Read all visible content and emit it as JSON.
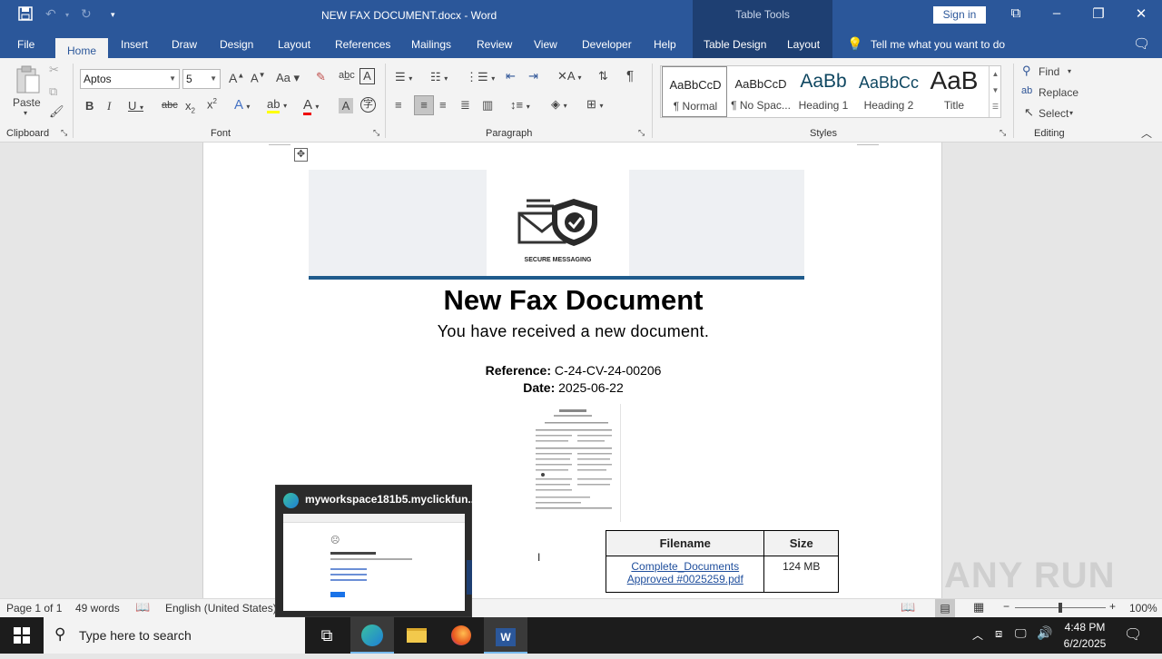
{
  "titlebar": {
    "doc_title": "NEW FAX DOCUMENT.docx  -  Word",
    "contextual_group": "Table Tools",
    "sign_in": "Sign in"
  },
  "tabs": {
    "file": "File",
    "home": "Home",
    "insert": "Insert",
    "draw": "Draw",
    "design": "Design",
    "layout": "Layout",
    "references": "References",
    "mailings": "Mailings",
    "review": "Review",
    "view": "View",
    "developer": "Developer",
    "help": "Help",
    "table_design": "Table Design",
    "table_layout": "Layout",
    "tell_me": "Tell me what you want to do"
  },
  "ribbon": {
    "clipboard": {
      "label": "Clipboard",
      "paste": "Paste"
    },
    "font": {
      "label": "Font",
      "name": "Aptos",
      "size": "5",
      "change_case": "Aa"
    },
    "paragraph": {
      "label": "Paragraph"
    },
    "styles": {
      "label": "Styles",
      "items": [
        {
          "preview": "AaBbCcD",
          "name": "¶ Normal"
        },
        {
          "preview": "AaBbCcD",
          "name": "¶ No Spac..."
        },
        {
          "preview": "AaBb",
          "name": "Heading 1"
        },
        {
          "preview": "AaBbCc",
          "name": "Heading 2"
        },
        {
          "preview": "AaB",
          "name": "Title"
        }
      ]
    },
    "editing": {
      "label": "Editing",
      "find": "Find",
      "replace": "Replace",
      "select": "Select"
    }
  },
  "document": {
    "banner_caption": "SECURE MESSAGING",
    "title": "New Fax Document",
    "subtitle": "You have received a new document.",
    "reference_label": "Reference:",
    "reference_value": "C-24-CV-24-00206",
    "date_label": "Date:",
    "date_value": "2025-06-22",
    "table": {
      "headers": [
        "Filename",
        "Size"
      ],
      "rows": [
        {
          "filename_line1": "Complete_Documents",
          "filename_line2": "Approved #0025259.pdf",
          "size": "124 MB"
        }
      ]
    }
  },
  "statusbar": {
    "page": "Page 1 of 1",
    "words": "49 words",
    "language": "English (United States)",
    "zoom": "100%"
  },
  "taskbar": {
    "search_placeholder": "Type here to search",
    "time": "4:48 PM",
    "date": "6/2/2025",
    "preview_title": "myworkspace181b5.myclickfun..."
  },
  "watermark": "ANY RUN",
  "colors": {
    "word_blue": "#2b579a",
    "table_tools": "#1e3f72",
    "banner_bar": "#1f5b8c"
  }
}
